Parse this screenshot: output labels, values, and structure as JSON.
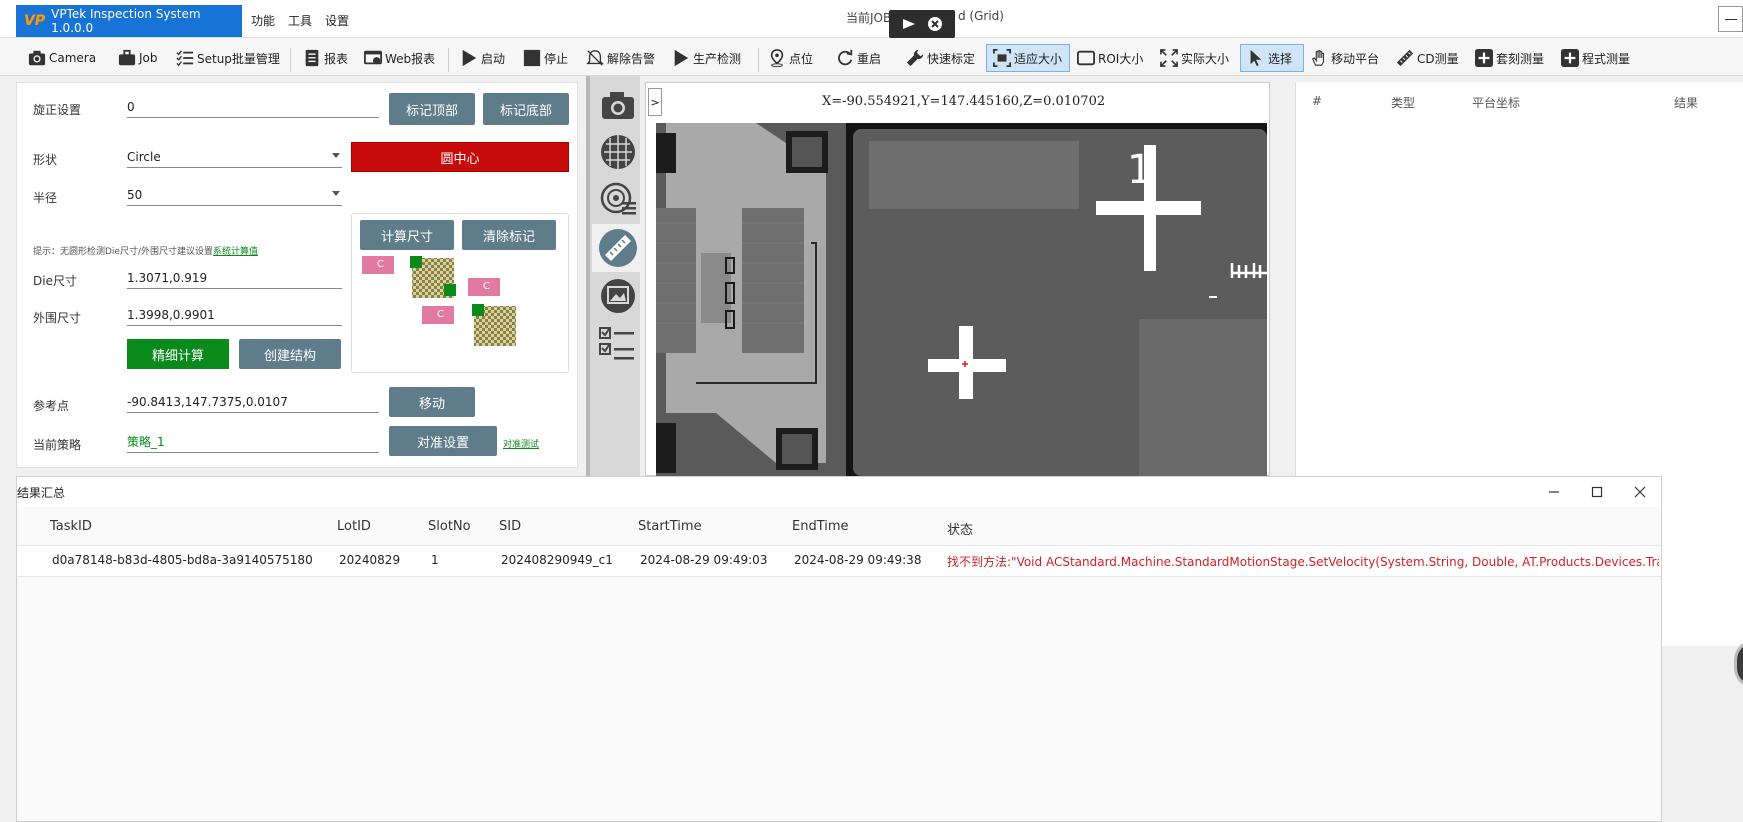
{
  "app": {
    "title": "VPTek Inspection System 1.0.0.0",
    "menu": [
      "功能",
      "工具",
      "设置"
    ],
    "center_title": "当前JOB",
    "center_title_tail": "d (Grid)"
  },
  "toolbar": {
    "items": [
      {
        "label": "Camera",
        "icon": "camera-icon"
      },
      {
        "label": "Job",
        "icon": "briefcase-icon"
      },
      {
        "label": "Setup批量管理",
        "icon": "checklist-icon"
      },
      {
        "label": "报表",
        "icon": "report-icon"
      },
      {
        "label": "Web报表",
        "icon": "web-report-icon"
      },
      {
        "label": "启动",
        "icon": "play-icon"
      },
      {
        "label": "停止",
        "icon": "stop-icon"
      },
      {
        "label": "解除告警",
        "icon": "bell-off-icon"
      },
      {
        "label": "生产检测",
        "icon": "play-icon"
      },
      {
        "label": "点位",
        "icon": "location-pin-icon"
      },
      {
        "label": "重启",
        "icon": "refresh-icon"
      },
      {
        "label": "快速标定",
        "icon": "wrench-icon"
      },
      {
        "label": "适应大小",
        "icon": "fit-size-icon"
      },
      {
        "label": "ROI大小",
        "icon": "roi-rect-icon"
      },
      {
        "label": "实际大小",
        "icon": "expand-icon"
      },
      {
        "label": "选择",
        "icon": "cursor-icon"
      },
      {
        "label": "移动平台",
        "icon": "hand-icon"
      },
      {
        "label": "CD测量",
        "icon": "ruler-icon"
      },
      {
        "label": "套刻测量",
        "icon": "plus-icon"
      },
      {
        "label": "程式测量",
        "icon": "plus-icon"
      }
    ]
  },
  "left_panel": {
    "rotation_label": "旋正设置",
    "rotation_value": "0",
    "mark_top": "标记顶部",
    "mark_bottom": "标记底部",
    "shape_label": "形状",
    "shape_value": "Circle",
    "circle_center": "圆中心",
    "radius_label": "半径",
    "radius_value": "50",
    "calc_size": "计算尺寸",
    "clear_mark": "清除标记",
    "hint_text": "提示：无圆形检测Die尺寸/外围尺寸建议设置",
    "hint_link": "系统计算值",
    "die_label": "Die尺寸",
    "die_value": "1.3071,0.919",
    "outer_label": "外围尺寸",
    "outer_value": "1.3998,0.9901",
    "fine_calc": "精细计算",
    "create_struct": "创建结构",
    "ref_label": "参考点",
    "ref_value": "-90.8413,147.7375,0.0107",
    "move": "移动",
    "strategy_label": "当前策略",
    "strategy_value": "策略_1",
    "align_settings": "对准设置",
    "align_test": "对准测试",
    "diagram_c": "C"
  },
  "viewer": {
    "coords": "X=-90.554921,Y=147.445160,Z=0.010702",
    "collapse": ">",
    "mark_label": "1"
  },
  "right_table": {
    "headers": [
      "#",
      "类型",
      "平台坐标",
      "结果"
    ]
  },
  "results": {
    "title": "结果汇总",
    "columns": [
      "TaskID",
      "LotID",
      "SlotNo",
      "SID",
      "StartTime",
      "EndTime",
      "状态"
    ],
    "rows": [
      {
        "task_id": "d0a78148-b83d-4805-bd8a-3a9140575180",
        "lot_id": "20240829",
        "slot_no": "1",
        "sid": "202408290949_c1",
        "start": "2024-08-29 09:49:03",
        "end": "2024-08-29 09:49:38",
        "status": "找不到方法:\"Void ACStandard.Machine.StandardMotionStage.SetVelocity(System.String, Double, AT.Products.Devices.Trac"
      }
    ]
  },
  "colors": {
    "brand_blue": "#1773d6",
    "red_button": "#c70a0a",
    "green_button": "#0a8a1a",
    "gray_button": "#5f7c8a",
    "error_text": "#d42020"
  }
}
